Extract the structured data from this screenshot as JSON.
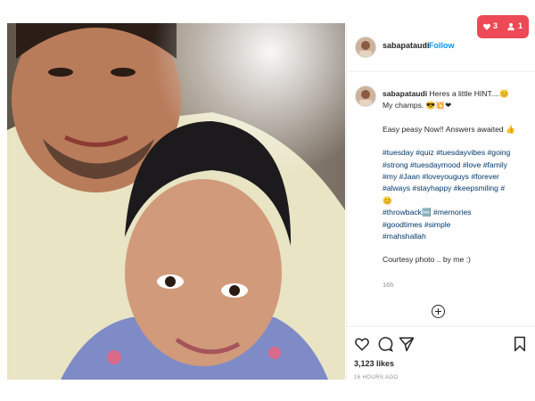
{
  "post": {
    "username": "sabapataudi",
    "follow_label": "Follow",
    "caption_user": "sabapataudi",
    "caption_lines": [
      "Heres a little HINT....😊",
      "My champs. 😎💥❤",
      "",
      "Easy peasy Now!! Answers awaited 👍",
      "",
      "#tuesday #quiz #tuesdayvibes #going",
      "#strong #tuesdaymood #love #family",
      "#my #Jaan #loveyouguys #forever",
      "#always #stayhappy #keepsmiling #",
      "😊",
      "#throwback🆒 #memories",
      "#goodtimes #simple",
      "#mahshallah",
      "",
      "Courtesy photo .. by me :)"
    ],
    "relative_time": "16h",
    "likes": "3,123 likes",
    "timestamp": "16 HOURS AGO"
  },
  "notifications": {
    "likes_count": "3",
    "followers_count": "1",
    "color": "#ed4956"
  },
  "icons": [
    "heart-icon",
    "comment-icon",
    "share-icon",
    "bookmark-icon",
    "add-comment-icon"
  ],
  "colors": {
    "link": "#0095f6",
    "hashtag": "#00376b"
  }
}
